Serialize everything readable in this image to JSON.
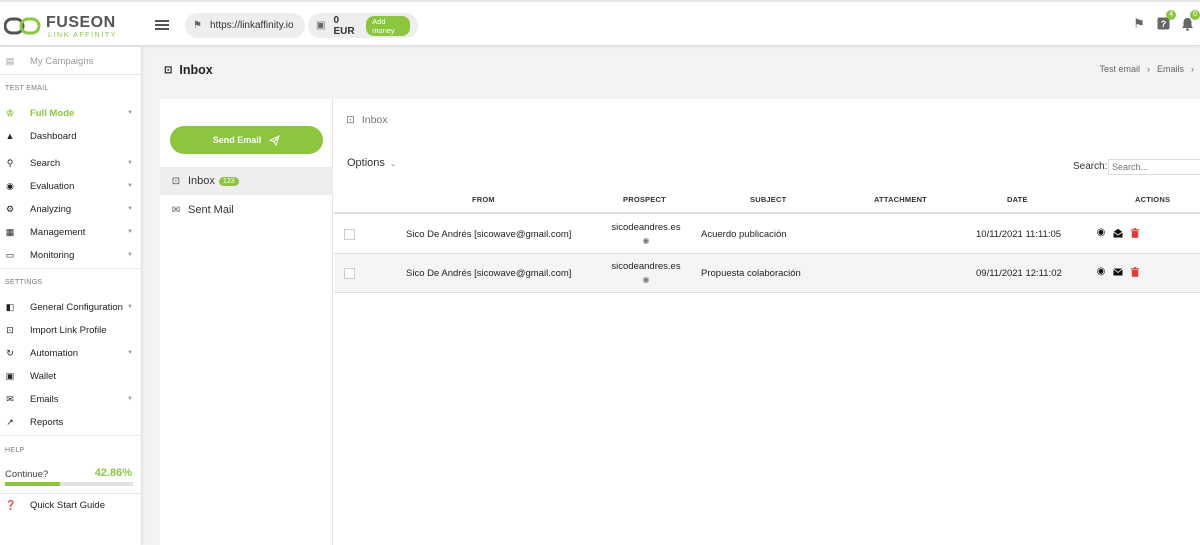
{
  "header": {
    "brand": "FUSEON",
    "brand_sub": "LINK AFFINITY",
    "url": "https://linkaffinity.io",
    "balance": "0 EUR",
    "add_money": "Add money",
    "notif_count": "4",
    "help_count": "0"
  },
  "sidebar": {
    "top_item": "My Campaigns",
    "section_test": "TEST EMAIL",
    "items_test": [
      {
        "label": "Full Mode",
        "icon": "crown-icon"
      },
      {
        "label": "Dashboard",
        "icon": "mountain-icon"
      },
      {
        "label": "Search",
        "icon": "search-icon"
      },
      {
        "label": "Evaluation",
        "icon": "eye-icon"
      },
      {
        "label": "Analyzing",
        "icon": "gear-icon"
      },
      {
        "label": "Management",
        "icon": "grid-icon"
      },
      {
        "label": "Monitoring",
        "icon": "monitor-icon"
      }
    ],
    "section_settings": "SETTINGS",
    "items_settings": [
      {
        "label": "General Configuration",
        "icon": "settings-door-icon"
      },
      {
        "label": "Import Link Profile",
        "icon": "import-icon"
      },
      {
        "label": "Automation",
        "icon": "sync-icon"
      },
      {
        "label": "Wallet",
        "icon": "wallet-icon"
      },
      {
        "label": "Emails",
        "icon": "mail-icon"
      },
      {
        "label": "Reports",
        "icon": "trend-icon"
      }
    ],
    "section_help": "HELP",
    "progress_label": "Continue?",
    "progress_value": "42.86%",
    "progress_fraction": 0.4286,
    "quick_start": "Quick Start Guide"
  },
  "page": {
    "title": "Inbox",
    "breadcrumb": [
      "Test email",
      "Emails"
    ]
  },
  "mailbox": {
    "send_email": "Send Email",
    "folders": [
      {
        "label": "Inbox",
        "count": "123"
      },
      {
        "label": "Sent Mail"
      }
    ]
  },
  "table": {
    "section_title": "Inbox",
    "options_label": "Options",
    "search_label": "Search:",
    "search_placeholder": "Search...",
    "columns": [
      "FROM",
      "PROSPECT",
      "SUBJECT",
      "ATTACHMENT",
      "DATE",
      "ACTIONS"
    ],
    "rows": [
      {
        "from": "Sico De Andrés [sicowave@gmail.com]",
        "prospect": "sicodeandres.es",
        "subject": "Acuerdo publicación",
        "attachment": "",
        "date": "10/11/2021 11:11:05"
      },
      {
        "from": "Sico De Andrés [sicowave@gmail.com]",
        "prospect": "sicodeandres.es",
        "subject": "Propuesta colaboración",
        "attachment": "",
        "date": "09/11/2021 12:11:02"
      }
    ]
  },
  "colors": {
    "accent": "#8cc63f",
    "delete": "#e53935"
  }
}
